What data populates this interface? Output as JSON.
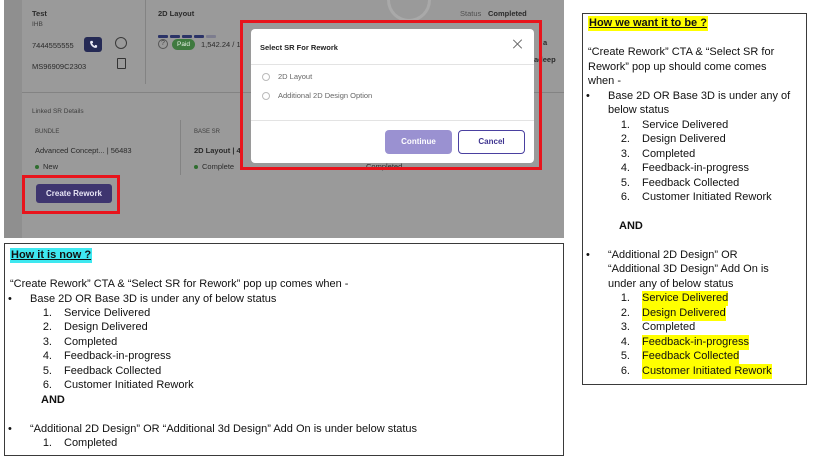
{
  "screenshot": {
    "left": {
      "name": "Test",
      "sub": "IHB",
      "phone": "7444555555",
      "id": "MS96909C2303"
    },
    "mid": {
      "title": "2D Layout",
      "badge": "Paid",
      "amount": "1,542.24 / 1"
    },
    "status_label": "Status",
    "status_value": "Completed",
    "right_partial_1": "a",
    "right_partial_2": "adeep",
    "linked": {
      "heading": "Linked SR Details",
      "bundle_label": "BUNDLE",
      "bundle_value": "Advanced Concept... | 56483",
      "bundle_status": "New",
      "base_label": "BASE SR",
      "base_value": "2D Layout | 4",
      "base_status": "Complete",
      "base_status_2": "Completed"
    },
    "create_rework_label": "Create Rework",
    "modal": {
      "title": "Select SR For Rework",
      "options": [
        "2D Layout",
        "Additional 2D Design Option"
      ],
      "continue_label": "Continue",
      "cancel_label": "Cancel"
    },
    "colors": {
      "highlight_border": "#e8141c",
      "primary_button": "#3e356f",
      "continue_button": "#9a91d1",
      "cancel_text": "#3f3590"
    }
  },
  "now_panel": {
    "title": "How it is now ?",
    "intro": "“Create Rework” CTA & “Select SR for Rework” pop up comes when -",
    "bullet1": "Base 2D OR Base 3D is under any of below status",
    "statuses": [
      "Service Delivered",
      "Design Delivered",
      "Completed",
      "Feedback-in-progress",
      "Feedback Collected",
      "Customer Initiated Rework"
    ],
    "and_label": "AND",
    "bullet2": "“Additional 2D Design” OR “Additional 3d Design” Add On is under  below status",
    "addon_statuses": [
      "Completed"
    ]
  },
  "want_panel": {
    "title": "How we want it to be ?",
    "intro_lines": [
      "“Create Rework” CTA & “Select SR for",
      "Rework” pop up should come comes",
      "when -"
    ],
    "bullet1_lines": [
      "Base 2D OR Base 3D is under any of",
      "below status"
    ],
    "statuses": [
      "Service Delivered",
      "Design Delivered",
      "Completed",
      "Feedback-in-progress",
      "Feedback Collected",
      "Customer Initiated Rework"
    ],
    "and_label": "AND",
    "bullet2_lines": [
      "“Additional 2D Design” OR",
      "“Additional 3D Design” Add On is",
      "under any of below status"
    ],
    "addon_statuses": [
      "Service Delivered",
      "Design Delivered",
      "Completed",
      "Feedback-in-progress",
      "Feedback Collected",
      "Customer Initiated Rework"
    ],
    "highlighted_items": [
      1,
      2,
      4,
      5,
      6
    ],
    "highlight_color": "#ffff00"
  }
}
